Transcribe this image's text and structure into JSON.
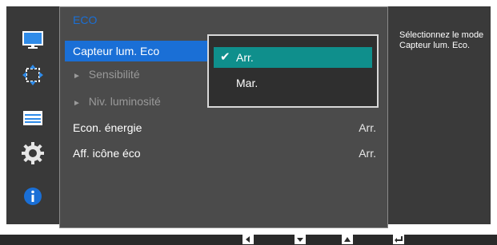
{
  "menu": {
    "title": "ECO",
    "items": [
      {
        "label": "Capteur lum. Eco",
        "value": ""
      },
      {
        "label": "Sensibilité",
        "value": ""
      },
      {
        "label": "Niv. luminosité",
        "value": ""
      },
      {
        "label": "Econ. énergie",
        "value": "Arr."
      },
      {
        "label": "Aff. icône éco",
        "value": "Arr."
      }
    ]
  },
  "popup": {
    "options": [
      "Arr.",
      "Mar."
    ]
  },
  "help": {
    "text": "Sélectionnez le mode Capteur lum. Eco."
  },
  "icons": [
    "monitor-icon",
    "position-icon",
    "settings-bar-icon",
    "gear-icon",
    "info-icon"
  ],
  "bottom_buttons": [
    "left-button",
    "down-button",
    "up-button",
    "enter-button"
  ],
  "colors": {
    "accent": "#1a6fd6",
    "option_selected": "#0f8f8c",
    "panel": "#4b4b4b"
  }
}
